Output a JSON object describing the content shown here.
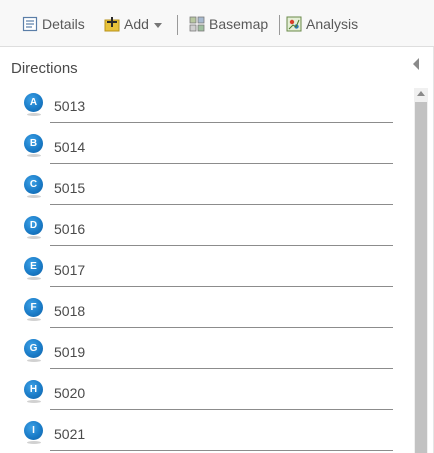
{
  "toolbar": {
    "details_label": "Details",
    "add_label": "Add",
    "basemap_label": "Basemap",
    "analysis_label": "Analysis"
  },
  "panel": {
    "title": "Directions"
  },
  "stops": [
    {
      "letter": "A",
      "value": "5013"
    },
    {
      "letter": "B",
      "value": "5014"
    },
    {
      "letter": "C",
      "value": "5015"
    },
    {
      "letter": "D",
      "value": "5016"
    },
    {
      "letter": "E",
      "value": "5017"
    },
    {
      "letter": "F",
      "value": "5018"
    },
    {
      "letter": "G",
      "value": "5019"
    },
    {
      "letter": "H",
      "value": "5020"
    },
    {
      "letter": "I",
      "value": "5021"
    }
  ],
  "colors": {
    "marker": "#1a7cc8",
    "toolbar_bg": "#f8f8f8",
    "text": "#4a4a4a"
  }
}
